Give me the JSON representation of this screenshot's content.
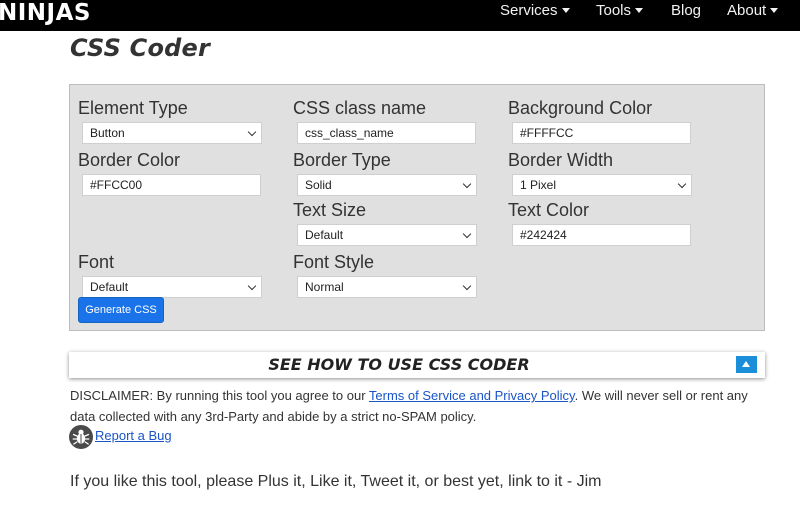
{
  "nav": {
    "brand": "NINJAS",
    "items": [
      {
        "label": "Services",
        "has_dropdown": true
      },
      {
        "label": "Tools",
        "has_dropdown": true
      },
      {
        "label": "Blog",
        "has_dropdown": false
      },
      {
        "label": "About",
        "has_dropdown": true
      }
    ]
  },
  "page": {
    "title": "CSS Coder"
  },
  "form": {
    "element_type": {
      "label": "Element Type",
      "value": "Button"
    },
    "css_class_name": {
      "label": "CSS class name",
      "value": "css_class_name"
    },
    "background_color": {
      "label": "Background Color",
      "value": "#FFFFCC"
    },
    "border_color": {
      "label": "Border Color",
      "value": "#FFCC00"
    },
    "border_type": {
      "label": "Border Type",
      "value": "Solid"
    },
    "border_width": {
      "label": "Border Width",
      "value": "1 Pixel"
    },
    "text_size": {
      "label": "Text Size",
      "value": "Default"
    },
    "text_color": {
      "label": "Text Color",
      "value": "#242424"
    },
    "font": {
      "label": "Font",
      "value": "Default"
    },
    "font_style": {
      "label": "Font Style",
      "value": "Normal"
    },
    "generate_label": "Generate CSS"
  },
  "howto": {
    "label": "SEE HOW TO USE CSS CODER"
  },
  "disclaimer": {
    "before": "DISCLAIMER: By running this tool you agree to our ",
    "link": "Terms of Service and Privacy Policy",
    "after": ". We will never sell or rent any data collected with any 3rd-Party and abide by a strict no-SPAM policy."
  },
  "bug": {
    "label": "Report a Bug"
  },
  "footer": {
    "text": "If you like this tool, please Plus it, Like it, Tweet it, or best yet, link to it - Jim"
  },
  "colors": {
    "nav_bg": "#000000",
    "panel_bg": "#e0e0e0",
    "button": "#1a73e8",
    "link": "#1a55c8",
    "toggle": "#1a8ed8"
  }
}
